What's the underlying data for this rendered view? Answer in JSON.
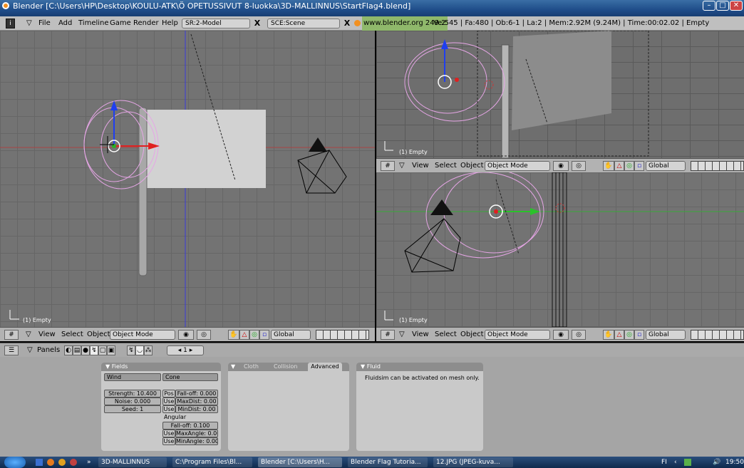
{
  "window": {
    "title": "Blender [C:\\Users\\HP\\Desktop\\KOULU-ATK\\Ö OPETUSSIVUT 8-luokka\\3D-MALLINNUS\\StartFlag4.blend]"
  },
  "menu": {
    "items": [
      "File",
      "Add",
      "Timeline",
      "Game",
      "Render",
      "Help"
    ],
    "screen": "SR:2-Model",
    "scene": "SCE:Scene",
    "status": "www.blender.org 249.2",
    "stats": "Ve:545 | Fa:480 | Ob:6-1 | La:2  | Mem:2.92M (9.24M)  | Time:00:02.02 | Empty"
  },
  "viewports": {
    "label": "(1) Empty"
  },
  "view_header": {
    "view": "View",
    "select": "Select",
    "object": "Object",
    "mode": "Object Mode",
    "orientation": "Global"
  },
  "buttons_header": {
    "panels": "Panels",
    "frame": "1"
  },
  "fields_panel": {
    "title": "Fields",
    "type": "Wind",
    "shape": "Cone",
    "strength": "Strength: 10.400",
    "noise": "Noise: 0.000",
    "seed": "Seed: 1",
    "pos": "Pos",
    "falloff": "Fall-off: 0.000",
    "use": "Use",
    "maxdist": "MaxDist: 0.00",
    "mindist": "MinDist: 0.00",
    "angular": "Angular",
    "ang_falloff": "Fall-off: 0.100",
    "maxangle": "MaxAngle: 0.00",
    "minangle": "MinAngle: 0.00"
  },
  "cloth_panel": {
    "tabs": [
      "Cloth",
      "Collision",
      "Advanced"
    ],
    "active": "Advanced"
  },
  "fluid_panel": {
    "title": "Fluid",
    "message": "Fluidsim can be activated on mesh only."
  },
  "taskbar": {
    "items": [
      "3D-MALLINNUS",
      "C:\\Program Files\\Bl...",
      "Blender [C:\\Users\\H...",
      "Blender Flag Tutoria...",
      "12.JPG (JPEG-kuva..."
    ],
    "lang": "FI",
    "time": "19:50"
  }
}
